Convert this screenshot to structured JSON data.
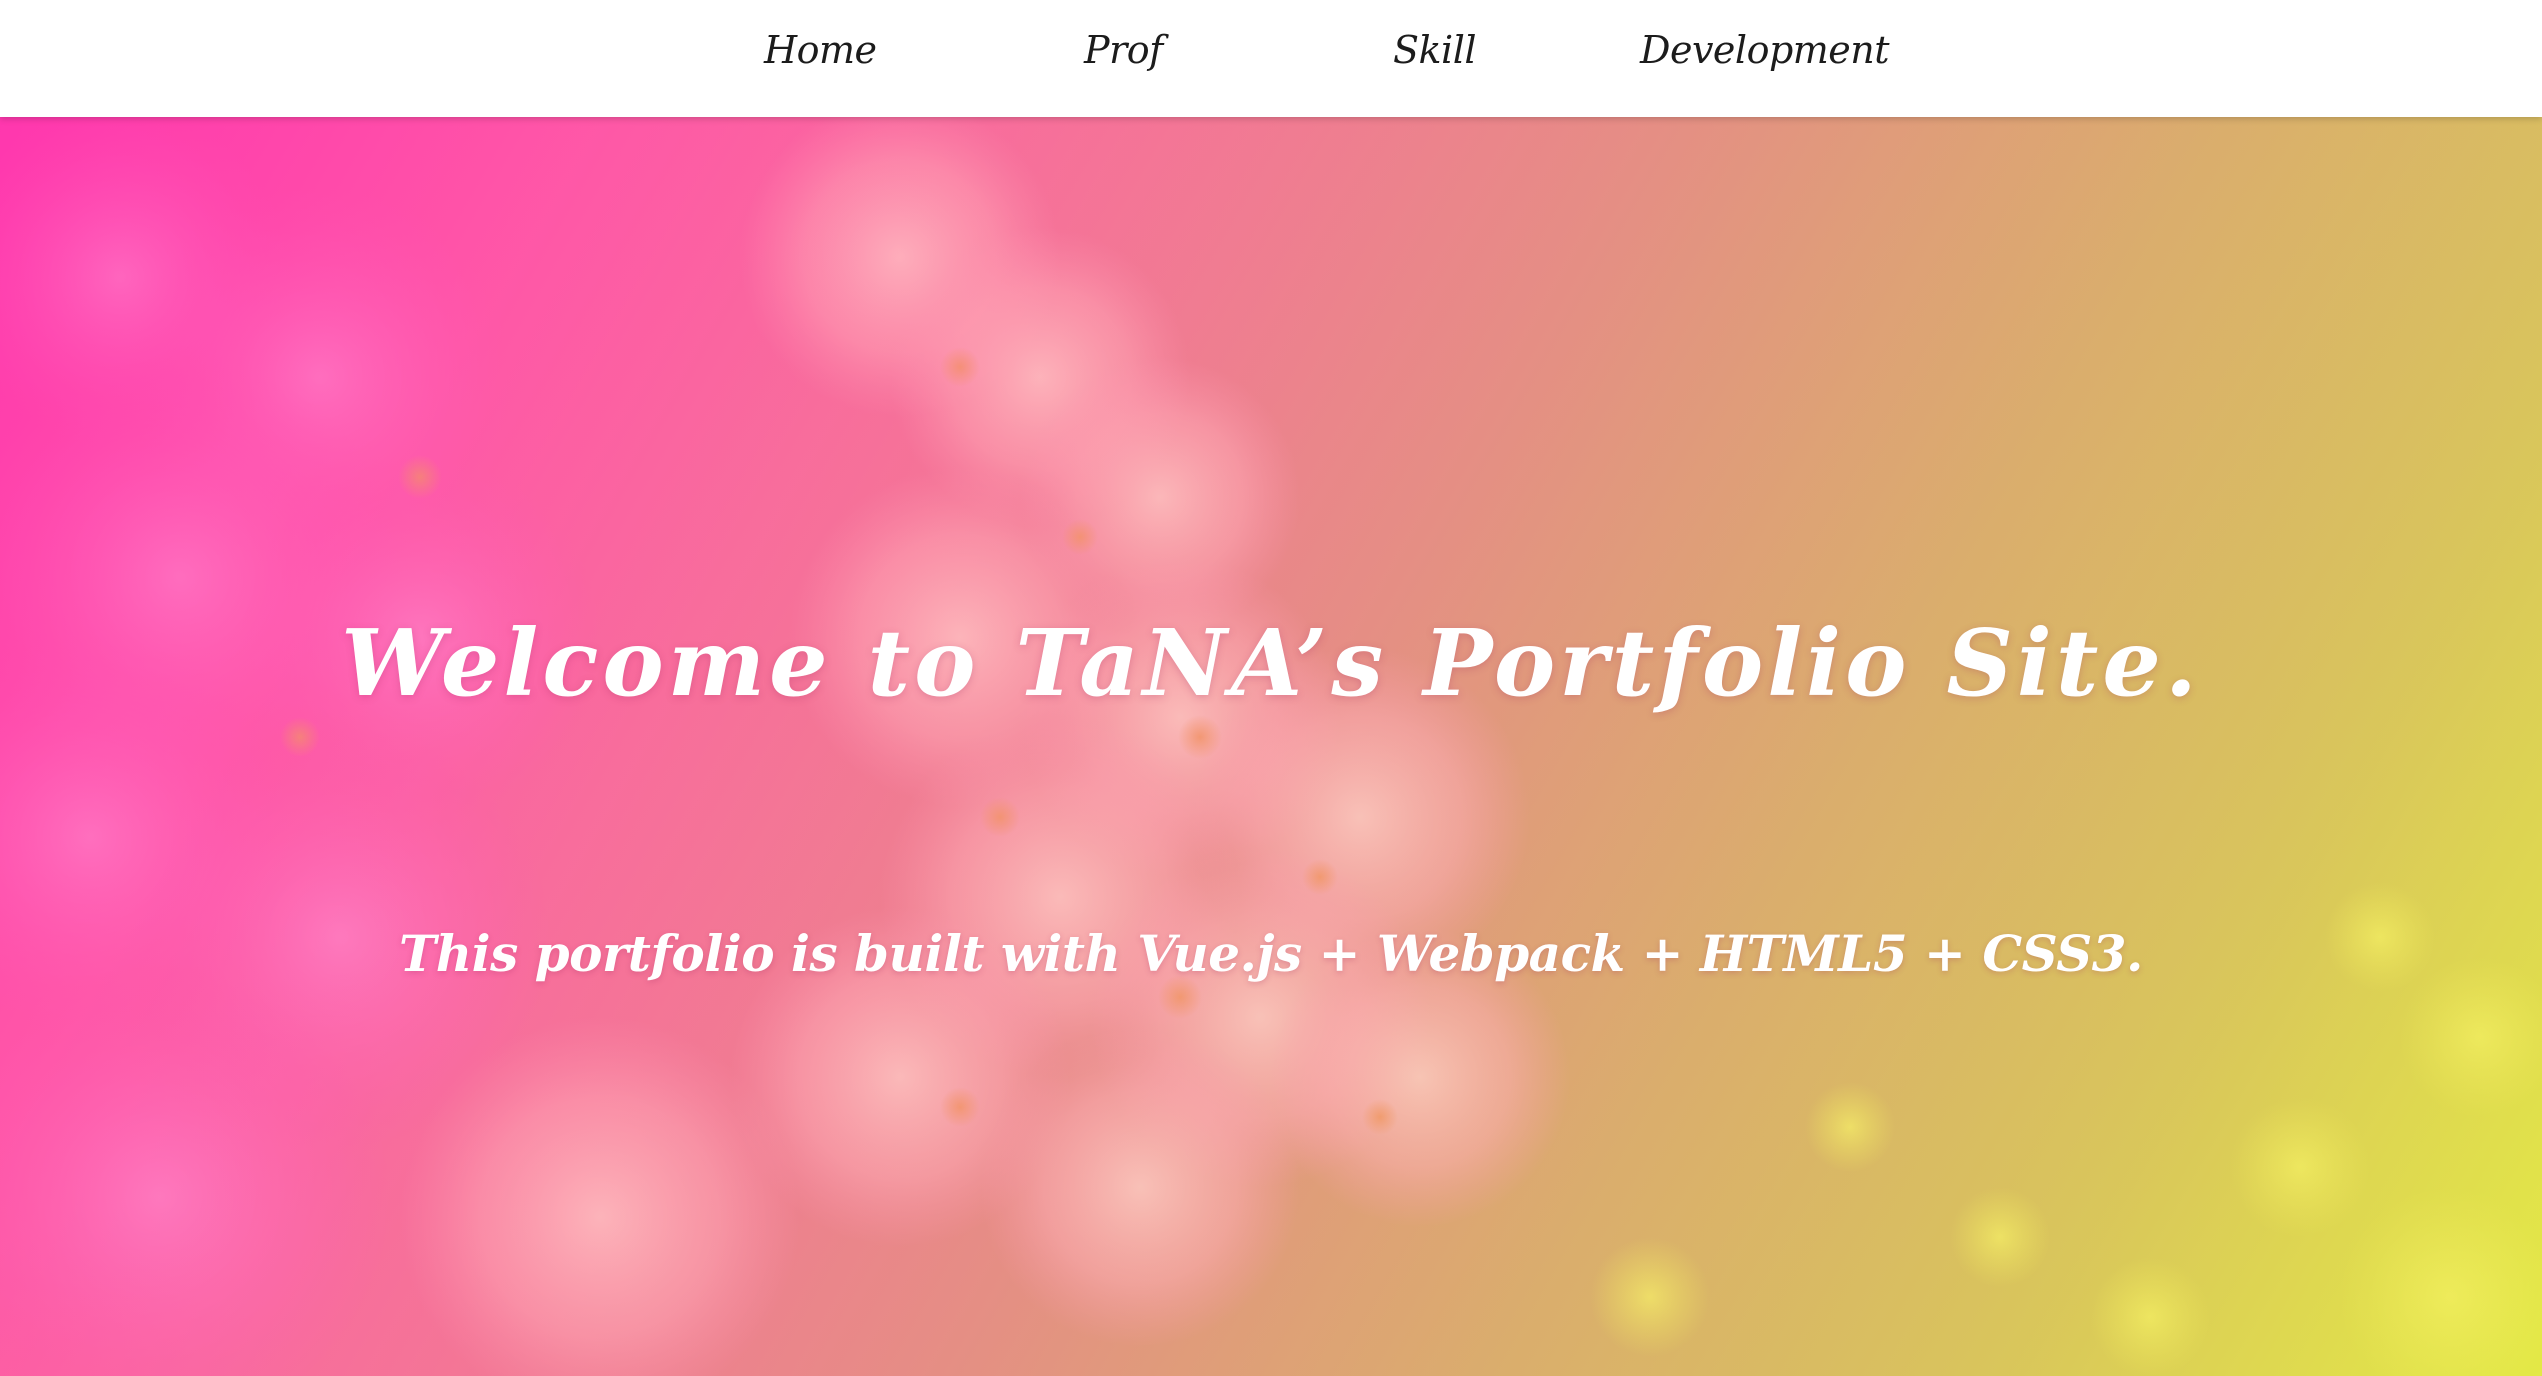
{
  "nav": {
    "items": [
      {
        "label": "Home"
      },
      {
        "label": "Prof"
      },
      {
        "label": "Skill"
      },
      {
        "label": "Development"
      }
    ]
  },
  "hero": {
    "title": "Welcome to TaNA’s Portfolio Site.",
    "subtitle": "This portfolio is built with Vue.js + Webpack + HTML5 + CSS3.",
    "background_image": "cherry-blossom-photo",
    "gradient_colors": [
      "#ff3fb0",
      "#e39282",
      "#e2e64a"
    ]
  }
}
